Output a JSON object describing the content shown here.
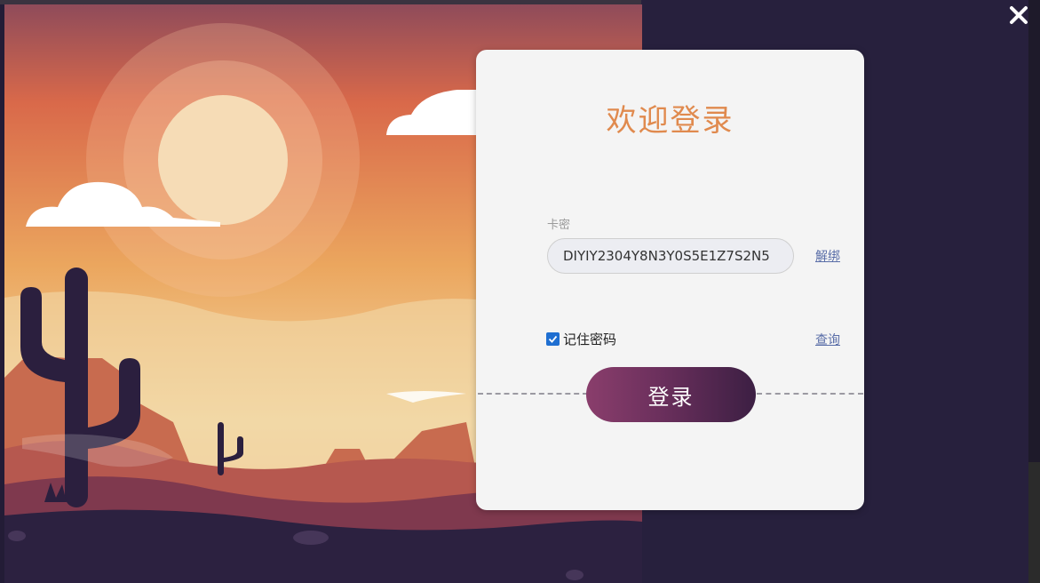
{
  "login": {
    "title": "欢迎登录",
    "card_key_label": "卡密",
    "card_key_value": "DIYIY2304Y8N3Y0S5E1Z7S2N5",
    "unbind_label": "解绑",
    "remember_label": "记住密码",
    "remember_checked": true,
    "query_label": "查询",
    "login_button_label": "登录"
  },
  "window": {
    "close_icon": "close-icon"
  },
  "colors": {
    "title": "#e08a4e",
    "card_bg": "#f4f4f4",
    "button_start": "#8a3e6c",
    "button_end": "#3c1f43",
    "checkbox": "#1f6fd1",
    "link": "#5a6ea8",
    "background": "#27203d"
  }
}
